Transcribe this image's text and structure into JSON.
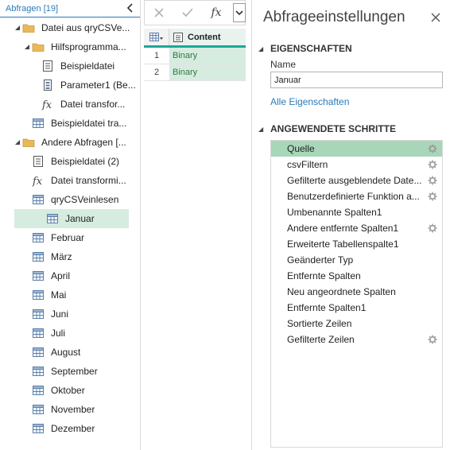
{
  "queries": {
    "title": "Abfragen [19]",
    "items": [
      {
        "label": "Datei aus qryCSVe...",
        "icon": "folder-icon",
        "twisty": "down"
      },
      {
        "label": "Hilfsprogramma...",
        "icon": "folder-icon",
        "twisty": "down"
      },
      {
        "label": "Beispieldatei",
        "icon": "query-doc-icon",
        "twisty": ""
      },
      {
        "label": "Parameter1 (Be...",
        "icon": "parameter-icon",
        "twisty": ""
      },
      {
        "label": "Datei transfor...",
        "icon": "function-icon",
        "twisty": ""
      },
      {
        "label": "Beispieldatei tra...",
        "icon": "table-icon",
        "twisty": ""
      },
      {
        "label": "Andere Abfragen [...",
        "icon": "folder-icon",
        "twisty": "down"
      },
      {
        "label": "Beispieldatei (2)",
        "icon": "query-doc-icon",
        "twisty": ""
      },
      {
        "label": "Datei transformi...",
        "icon": "function-icon",
        "twisty": ""
      },
      {
        "label": "qryCSVeinlesen",
        "icon": "table-icon",
        "twisty": ""
      },
      {
        "label": "Januar",
        "icon": "table-icon",
        "twisty": "",
        "selected": true
      },
      {
        "label": "Februar",
        "icon": "table-icon",
        "twisty": ""
      },
      {
        "label": "März",
        "icon": "table-icon",
        "twisty": ""
      },
      {
        "label": "April",
        "icon": "table-icon",
        "twisty": ""
      },
      {
        "label": "Mai",
        "icon": "table-icon",
        "twisty": ""
      },
      {
        "label": "Juni",
        "icon": "table-icon",
        "twisty": ""
      },
      {
        "label": "Juli",
        "icon": "table-icon",
        "twisty": ""
      },
      {
        "label": "August",
        "icon": "table-icon",
        "twisty": ""
      },
      {
        "label": "September",
        "icon": "table-icon",
        "twisty": ""
      },
      {
        "label": "Oktober",
        "icon": "table-icon",
        "twisty": ""
      },
      {
        "label": "November",
        "icon": "table-icon",
        "twisty": ""
      },
      {
        "label": "Dezember",
        "icon": "table-icon",
        "twisty": ""
      }
    ]
  },
  "formula_bar": {
    "cancel_icon": "close-icon",
    "confirm_icon": "check-icon",
    "fx_label": "fx",
    "expand_icon": "chevron-down-icon"
  },
  "grid": {
    "column_header": "Content",
    "rows": [
      {
        "num": "1",
        "value": "Binary"
      },
      {
        "num": "2",
        "value": "Binary"
      }
    ]
  },
  "settings": {
    "title": "Abfrageeinstellungen",
    "properties_header": "EIGENSCHAFTEN",
    "name_label": "Name",
    "name_value": "Januar",
    "all_properties_link": "Alle Eigenschaften",
    "steps_header": "ANGEWENDETE SCHRITTE",
    "steps": [
      {
        "label": "Quelle",
        "gear": true,
        "selected": true
      },
      {
        "label": "csvFiltern",
        "gear": true
      },
      {
        "label": "Gefilterte ausgeblendete Date...",
        "gear": true
      },
      {
        "label": "Benutzerdefinierte Funktion a...",
        "gear": true
      },
      {
        "label": "Umbenannte Spalten1",
        "gear": false
      },
      {
        "label": "Andere entfernte Spalten1",
        "gear": true
      },
      {
        "label": "Erweiterte Tabellenspalte1",
        "gear": false
      },
      {
        "label": "Geänderter Typ",
        "gear": false
      },
      {
        "label": "Entfernte Spalten",
        "gear": false
      },
      {
        "label": "Neu angeordnete Spalten",
        "gear": false
      },
      {
        "label": "Entfernte Spalten1",
        "gear": false
      },
      {
        "label": "Sortierte Zeilen",
        "gear": false
      },
      {
        "label": "Gefilterte Zeilen",
        "gear": true
      }
    ]
  },
  "colors": {
    "accent_blue": "#2a7ab9",
    "selected_row": "#d7ece0",
    "selected_step": "#a7d7b8",
    "teal": "#1aa79b",
    "binary_text": "#2d7a3e"
  }
}
